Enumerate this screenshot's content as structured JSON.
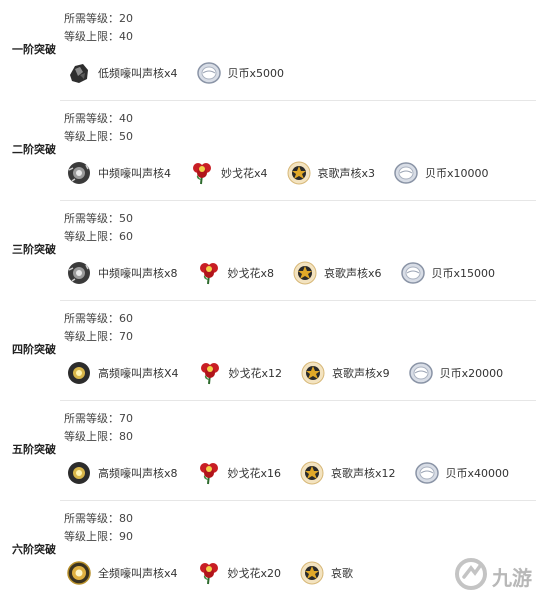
{
  "labels": {
    "req_level": "所需等级：",
    "level_cap": "等级上限："
  },
  "stages": [
    {
      "name": "一阶突破",
      "req_level": "20",
      "level_cap": "40",
      "items": [
        {
          "icon": "low-frequency-core-icon",
          "label": "低频嚎叫声核x4"
        },
        {
          "icon": "shell-credit-icon",
          "label": "贝币x5000"
        }
      ]
    },
    {
      "name": "二阶突破",
      "req_level": "40",
      "level_cap": "50",
      "items": [
        {
          "icon": "mid-frequency-core-icon",
          "label": "中频嚎叫声核4"
        },
        {
          "icon": "flower-icon",
          "label": "妙戈花x4"
        },
        {
          "icon": "elegy-core-icon",
          "label": "哀歌声核x3"
        },
        {
          "icon": "shell-credit-icon",
          "label": "贝币x10000"
        }
      ]
    },
    {
      "name": "三阶突破",
      "req_level": "50",
      "level_cap": "60",
      "items": [
        {
          "icon": "mid-frequency-core-icon",
          "label": "中频嚎叫声核x8"
        },
        {
          "icon": "flower-icon",
          "label": "妙戈花x8"
        },
        {
          "icon": "elegy-core-icon",
          "label": "哀歌声核x6"
        },
        {
          "icon": "shell-credit-icon",
          "label": "贝币x15000"
        }
      ]
    },
    {
      "name": "四阶突破",
      "req_level": "60",
      "level_cap": "70",
      "items": [
        {
          "icon": "high-frequency-core-icon",
          "label": "高频嚎叫声核X4"
        },
        {
          "icon": "flower-icon",
          "label": "妙戈花x12"
        },
        {
          "icon": "elegy-core-icon",
          "label": "哀歌声核x9"
        },
        {
          "icon": "shell-credit-icon",
          "label": "贝币x20000"
        }
      ]
    },
    {
      "name": "五阶突破",
      "req_level": "70",
      "level_cap": "80",
      "items": [
        {
          "icon": "high-frequency-core-icon",
          "label": "高频嚎叫声核x8"
        },
        {
          "icon": "flower-icon",
          "label": "妙戈花x16"
        },
        {
          "icon": "elegy-core-icon",
          "label": "哀歌声核x12"
        },
        {
          "icon": "shell-credit-icon",
          "label": "贝币x40000"
        }
      ]
    },
    {
      "name": "六阶突破",
      "req_level": "80",
      "level_cap": "90",
      "items": [
        {
          "icon": "full-frequency-core-icon",
          "label": "全频嚎叫声核x4"
        },
        {
          "icon": "flower-icon",
          "label": "妙戈花x20"
        },
        {
          "icon": "elegy-core-icon",
          "label": "哀歌"
        }
      ]
    }
  ],
  "watermark": {
    "text": "九游",
    "icon": "jiuyou-logo-icon"
  }
}
